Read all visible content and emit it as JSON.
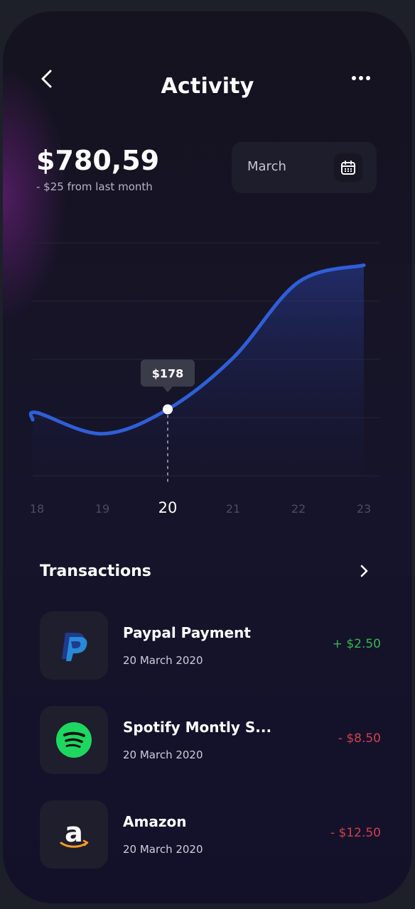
{
  "header": {
    "title": "Activity"
  },
  "summary": {
    "balance": "$780,59",
    "change_note": "- $25 from last month"
  },
  "month_picker": {
    "value": "March"
  },
  "chart_data": {
    "type": "area",
    "x": [
      18,
      19,
      20,
      21,
      22,
      23
    ],
    "x_labels": [
      "18",
      "19",
      "20",
      "21",
      "22",
      "23"
    ],
    "selected_x_label": "20",
    "selected_value_label": "$178",
    "series": [
      {
        "values": [
          170,
          120,
          178,
          300,
          480,
          520
        ]
      }
    ],
    "ylim": [
      0,
      600
    ],
    "grid": true,
    "colors": {
      "line": "#2f5fd8",
      "point": "#ffffff",
      "tooltip_bg": "#3a3c4a"
    }
  },
  "transactions": {
    "title": "Transactions",
    "items": [
      {
        "name": "Paypal Payment",
        "date": "20 March 2020",
        "amount": "+ $2.50",
        "icon": "paypal-icon"
      },
      {
        "name": "Spotify Montly S...",
        "date": "20 March 2020",
        "amount": "- $8.50",
        "icon": "spotify-icon"
      },
      {
        "name": "Amazon",
        "date": "20 March 2020",
        "amount": "- $12.50",
        "icon": "amazon-icon"
      }
    ]
  }
}
